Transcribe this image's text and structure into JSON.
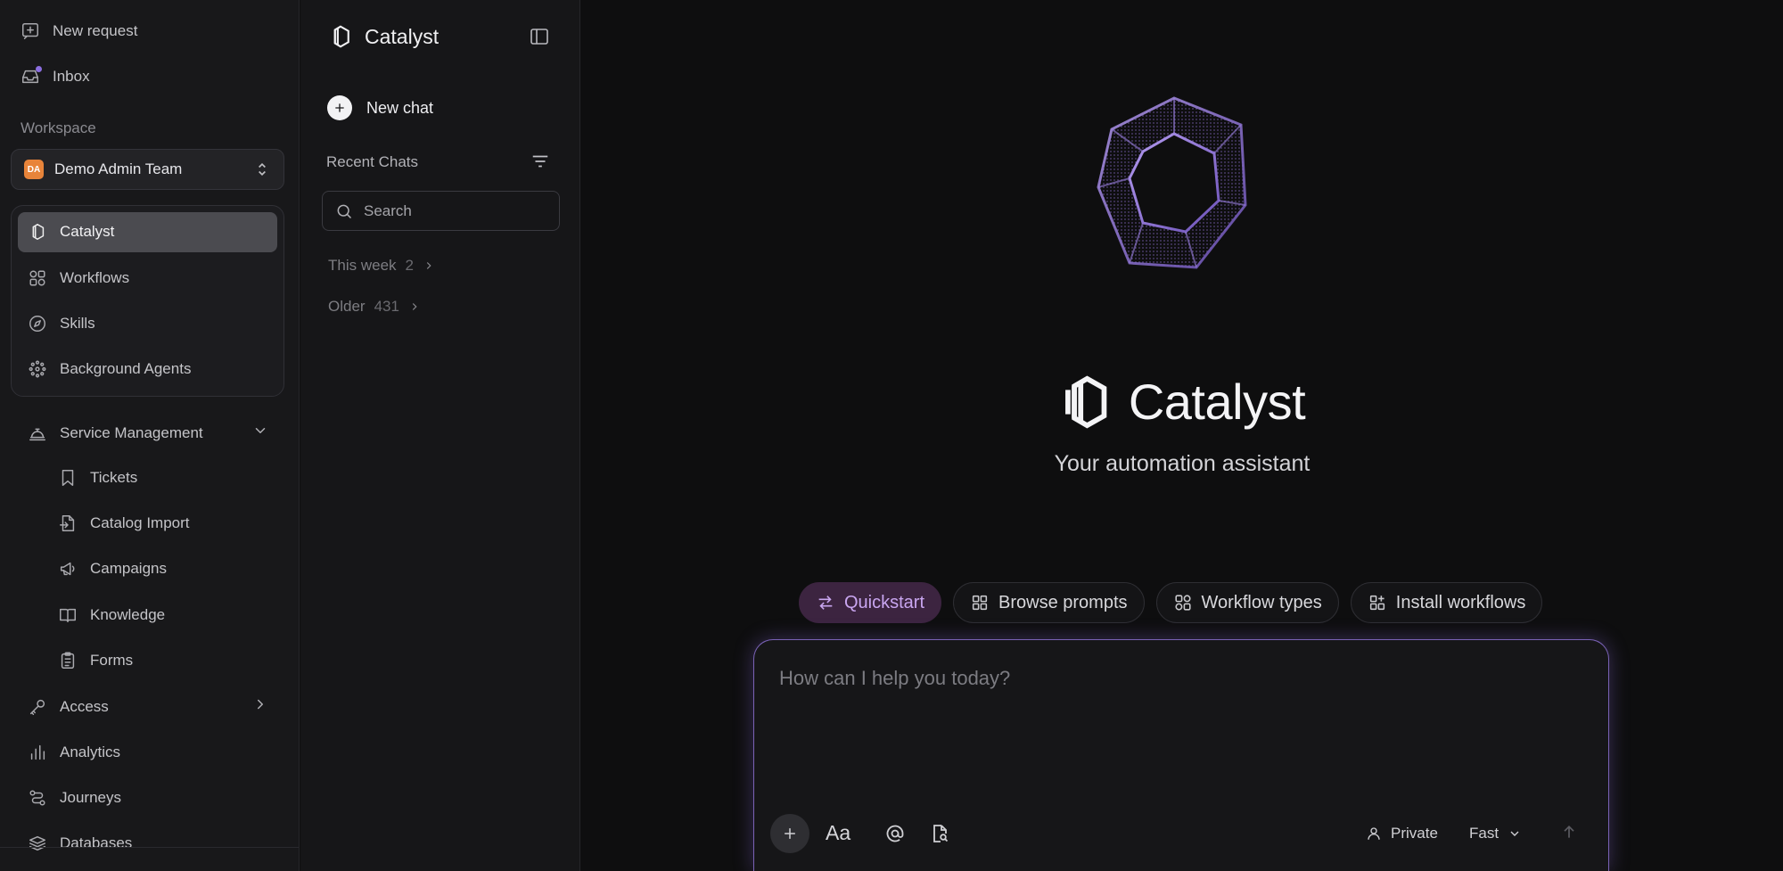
{
  "sidebar": {
    "top": [
      {
        "label": "New request",
        "icon": "new-request-icon"
      },
      {
        "label": "Inbox",
        "icon": "inbox-icon",
        "has_notification": true
      }
    ],
    "workspace_label": "Workspace",
    "workspace": {
      "badge": "DA",
      "name": "Demo Admin Team",
      "badge_color": "#e8843a"
    },
    "group": [
      {
        "label": "Catalyst",
        "icon": "catalyst-icon",
        "active": true
      },
      {
        "label": "Workflows",
        "icon": "workflows-icon"
      },
      {
        "label": "Skills",
        "icon": "compass-icon"
      },
      {
        "label": "Background Agents",
        "icon": "agents-icon"
      }
    ],
    "service_management": {
      "label": "Service Management",
      "expanded": true,
      "children": [
        "Tickets",
        "Catalog Import",
        "Campaigns",
        "Knowledge",
        "Forms"
      ]
    },
    "bottom": [
      {
        "label": "Access",
        "icon": "key-icon",
        "has_children": true
      },
      {
        "label": "Analytics",
        "icon": "analytics-icon"
      },
      {
        "label": "Journeys",
        "icon": "journeys-icon"
      },
      {
        "label": "Databases",
        "icon": "database-icon"
      }
    ]
  },
  "panel": {
    "title": "Catalyst",
    "new_chat": "New chat",
    "recent_label": "Recent Chats",
    "search_placeholder": "Search",
    "groups": [
      {
        "label": "This week",
        "count": "2"
      },
      {
        "label": "Older",
        "count": "431"
      }
    ]
  },
  "main": {
    "brand": "Catalyst",
    "tagline": "Your automation assistant",
    "chips": [
      {
        "label": "Quickstart",
        "active": true
      },
      {
        "label": "Browse prompts"
      },
      {
        "label": "Workflow types"
      },
      {
        "label": "Install workflows"
      }
    ],
    "composer": {
      "placeholder": "How can I help you today?",
      "format_label": "Aa",
      "privacy": "Private",
      "model": "Fast"
    },
    "accent": "#9b7ad8"
  }
}
